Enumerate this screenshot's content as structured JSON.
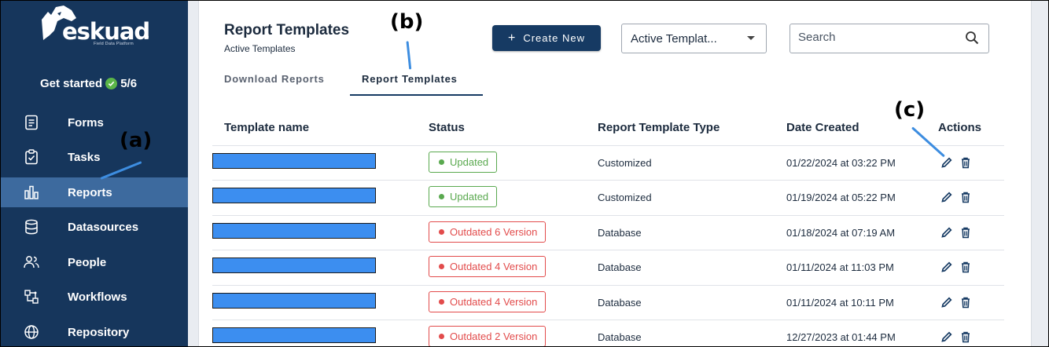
{
  "brand": {
    "name": "eskuad",
    "tagline": "Field Data Platform"
  },
  "get_started": {
    "label": "Get started",
    "progress": "5/6"
  },
  "sidebar": {
    "items": [
      {
        "label": "Forms",
        "icon": "forms-icon"
      },
      {
        "label": "Tasks",
        "icon": "tasks-icon"
      },
      {
        "label": "Reports",
        "icon": "reports-icon",
        "active": true
      },
      {
        "label": "Datasources",
        "icon": "database-icon"
      },
      {
        "label": "People",
        "icon": "people-icon"
      },
      {
        "label": "Workflows",
        "icon": "workflows-icon"
      },
      {
        "label": "Repository",
        "icon": "globe-icon"
      }
    ]
  },
  "header": {
    "title": "Report Templates",
    "subtitle": "Active Templates"
  },
  "toolbar": {
    "create_label": "Create New",
    "filter_value": "Active Templat...",
    "search_placeholder": "Search"
  },
  "tabs": [
    {
      "label": "Download Reports",
      "active": false
    },
    {
      "label": "Report Templates",
      "active": true
    }
  ],
  "table": {
    "columns": [
      "Template name",
      "Status",
      "Report Template Type",
      "Date Created",
      "Actions"
    ],
    "rows": [
      {
        "status": "Updated",
        "status_kind": "ok",
        "type": "Customized",
        "date": "01/22/2024 at 03:22 PM"
      },
      {
        "status": "Updated",
        "status_kind": "ok",
        "type": "Customized",
        "date": "01/19/2024 at 05:22 PM"
      },
      {
        "status": "Outdated 6 Version",
        "status_kind": "bad",
        "type": "Database",
        "date": "01/18/2024 at 07:19 AM"
      },
      {
        "status": "Outdated 4 Version",
        "status_kind": "bad",
        "type": "Database",
        "date": "01/11/2024 at 11:03 PM"
      },
      {
        "status": "Outdated 4 Version",
        "status_kind": "bad",
        "type": "Database",
        "date": "01/11/2024 at 10:11 PM"
      },
      {
        "status": "Outdated 2 Version",
        "status_kind": "bad",
        "type": "Database",
        "date": "12/27/2023 at 01:44 PM"
      }
    ]
  },
  "annotations": {
    "a": "(a)",
    "b": "(b)",
    "c": "(c)"
  },
  "colors": {
    "sidebar": "#16365c",
    "active_nav": "#3d6a9e",
    "primary_button": "#163a63",
    "ok": "#5aa94f",
    "bad": "#e24b4b",
    "redaction": "#3c8ef0",
    "annotation_line": "#3d8de0"
  }
}
